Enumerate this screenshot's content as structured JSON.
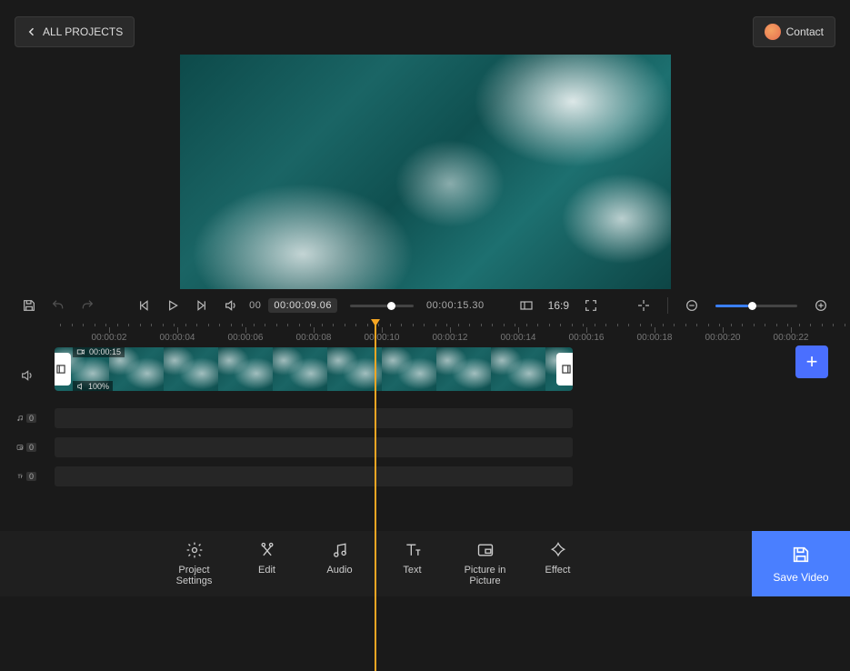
{
  "header": {
    "all_projects_label": "ALL PROJECTS",
    "contact_label": "Contact"
  },
  "playback": {
    "current_time_prefix": "00",
    "current_time": "00:00:09.06",
    "total_time": "00:00:15.30",
    "aspect_ratio": "16:9"
  },
  "timeline": {
    "ruler_labels": [
      "00:00:02",
      "00:00:04",
      "00:00:06",
      "00:00:08",
      "00:00:10",
      "00:00:12",
      "00:00:14",
      "00:00:16",
      "00:00:18",
      "00:00:20",
      "00:00:22"
    ],
    "clip_duration": "00:00:15",
    "clip_volume": "100%",
    "audio_track_count": "0",
    "pip_track_count": "0",
    "text_track_count": "0"
  },
  "tools": {
    "project_settings": "Project\nSettings",
    "edit": "Edit",
    "audio": "Audio",
    "text": "Text",
    "pip": "Picture in\nPicture",
    "effect": "Effect",
    "save_video": "Save Video"
  }
}
